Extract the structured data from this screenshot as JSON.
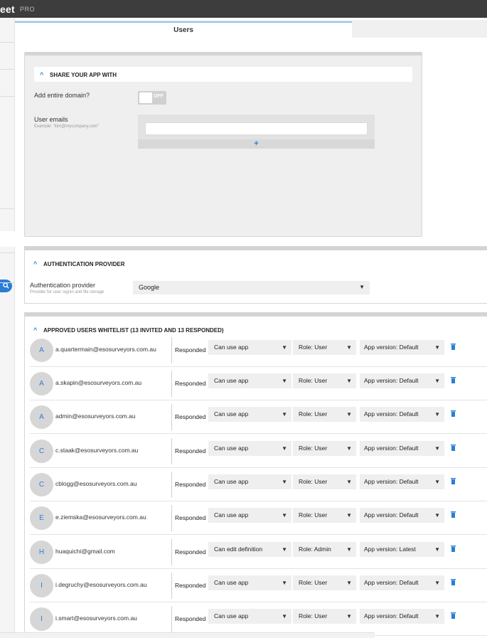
{
  "app": {
    "brand": "eet",
    "edition": "PRO"
  },
  "tabs": {
    "users": "Users"
  },
  "share": {
    "title": "SHARE YOUR APP WITH",
    "add_domain_label": "Add entire domain?",
    "toggle_state": "OFF",
    "user_emails_label": "User emails",
    "user_emails_example": "Example: \"kim@mycompany.com\"",
    "add_symbol": "+"
  },
  "auth": {
    "title": "AUTHENTICATION PROVIDER",
    "label": "Authentication provider",
    "sublabel": "Provider for user signin and file storage",
    "value": "Google"
  },
  "whitelist": {
    "title": "APPROVED USERS WHITELIST (13 INVITED AND 13 RESPONDED)",
    "rows": [
      {
        "initial": "A",
        "email": "a.quartermain@esosurveyors.com.au",
        "status": "Responded",
        "permission": "Can use app",
        "role": "Role: User",
        "version": "App version: Default"
      },
      {
        "initial": "A",
        "email": "a.skapin@esosurveyors.com.au",
        "status": "Responded",
        "permission": "Can use app",
        "role": "Role: User",
        "version": "App version: Default"
      },
      {
        "initial": "A",
        "email": "admin@esosurveyors.com.au",
        "status": "Responded",
        "permission": "Can use app",
        "role": "Role: User",
        "version": "App version: Default"
      },
      {
        "initial": "C",
        "email": "c.staak@esosurveyors.com.au",
        "status": "Responded",
        "permission": "Can use app",
        "role": "Role: User",
        "version": "App version: Default"
      },
      {
        "initial": "C",
        "email": "cblogg@esosurveyors.com.au",
        "status": "Responded",
        "permission": "Can use app",
        "role": "Role: User",
        "version": "App version: Default"
      },
      {
        "initial": "E",
        "email": "e.ziemska@esosurveyors.com.au",
        "status": "Responded",
        "permission": "Can use app",
        "role": "Role: User",
        "version": "App version: Default"
      },
      {
        "initial": "H",
        "email": "huaquichi@gmail.com",
        "status": "Responded",
        "permission": "Can edit definition",
        "role": "Role: Admin",
        "version": "App version: Latest"
      },
      {
        "initial": "I",
        "email": "i.degruchy@esosurveyors.com.au",
        "status": "Responded",
        "permission": "Can use app",
        "role": "Role: User",
        "version": "App version: Default"
      },
      {
        "initial": "I",
        "email": "i.smart@esosurveyors.com.au",
        "status": "Responded",
        "permission": "Can use app",
        "role": "Role: User",
        "version": "App version: Default"
      }
    ]
  },
  "icons": {
    "search": "search-icon",
    "delete": "trash-icon",
    "collapse": "chevron-up-icon",
    "dropdown": "caret-down-icon"
  },
  "colors": {
    "accent": "#2a7ed6",
    "topbar": "#3d3d3d"
  }
}
